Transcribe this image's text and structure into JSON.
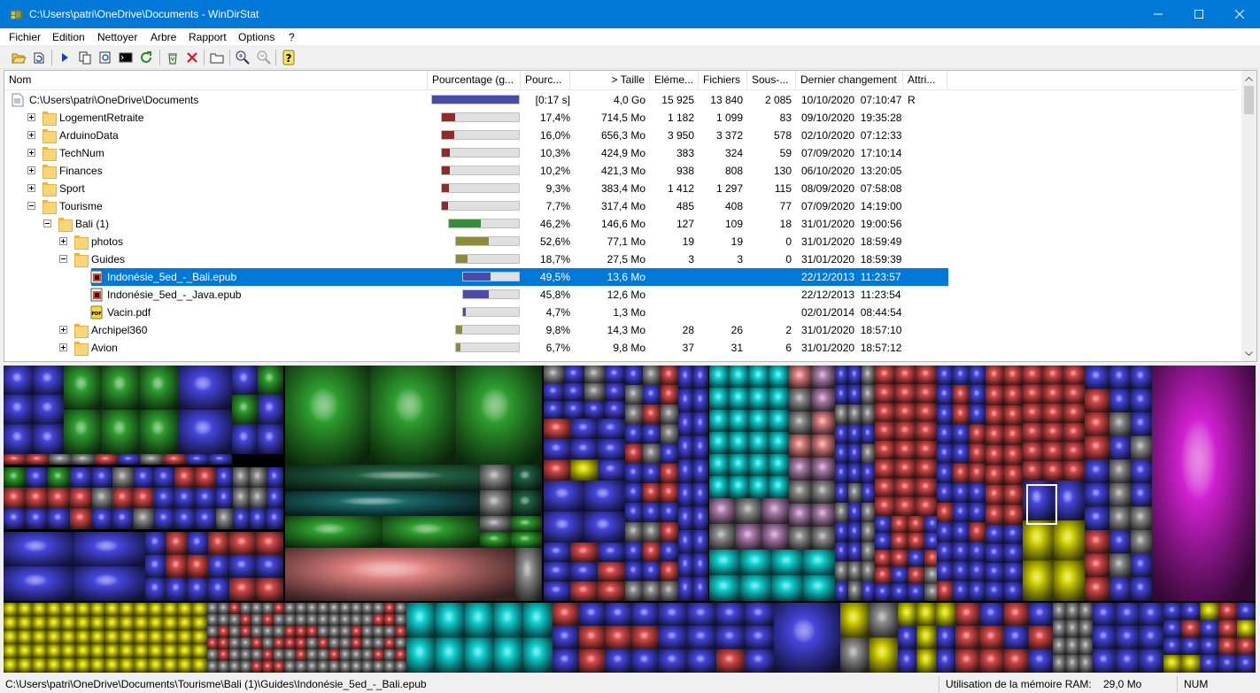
{
  "window": {
    "title": "C:\\Users\\patri\\OneDrive\\Documents - WinDirStat",
    "minimize_icon": "minimize-icon",
    "maximize_icon": "maximize-icon",
    "close_icon": "close-icon"
  },
  "menu": [
    "Fichier",
    "Edition",
    "Nettoyer",
    "Arbre",
    "Rapport",
    "Options",
    "?"
  ],
  "toolbar": {
    "icons": [
      "open-icon",
      "refresh-all-icon",
      "play-icon",
      "copy-path-icon",
      "explorer-icon",
      "command-prompt-icon",
      "refresh-icon",
      "recycle-bin-icon",
      "delete-icon",
      "new-folder-icon",
      "zoom-in-icon",
      "zoom-out-icon",
      "help-icon"
    ]
  },
  "columns": {
    "nom": "Nom",
    "pourcentage_graph": "Pourcentage (g...",
    "pourcentage": "Pourc...",
    "taille": "> Taille",
    "elements": "Eléme...",
    "fichiers": "Fichiers",
    "sous_dossiers": "Sous-...",
    "dernier_changement": "Dernier changement",
    "attributs": "Attri..."
  },
  "rows": [
    {
      "name": "C:\\Users\\patri\\OneDrive\\Documents",
      "type": "root",
      "bar_fraction": 1.0,
      "bar_color": "#4a4aa8",
      "pct": "[0:17 s]",
      "size": "4,0 Go",
      "items": "15 925",
      "files": "13 840",
      "subdirs": "2 085",
      "date": "10/10/2020  07:10:47",
      "attr": "R"
    },
    {
      "name": "LogementRetraite",
      "type": "folder",
      "expander": "plus",
      "bar_fraction": 0.174,
      "bar_color": "#8b2b2b",
      "pct": "17,4%",
      "size": "714,5 Mo",
      "items": "1 182",
      "files": "1 099",
      "subdirs": "83",
      "date": "09/10/2020  19:35:28",
      "attr": ""
    },
    {
      "name": "ArduinoData",
      "type": "folder",
      "expander": "plus",
      "bar_fraction": 0.16,
      "bar_color": "#8b2b2b",
      "pct": "16,0%",
      "size": "656,3 Mo",
      "items": "3 950",
      "files": "3 372",
      "subdirs": "578",
      "date": "02/10/2020  07:12:33",
      "attr": ""
    },
    {
      "name": "TechNum",
      "type": "folder",
      "expander": "plus",
      "bar_fraction": 0.103,
      "bar_color": "#8b2b2b",
      "pct": "10,3%",
      "size": "424,9 Mo",
      "items": "383",
      "files": "324",
      "subdirs": "59",
      "date": "07/09/2020  17:10:14",
      "attr": ""
    },
    {
      "name": "Finances",
      "type": "folder",
      "expander": "plus",
      "bar_fraction": 0.102,
      "bar_color": "#8b2b2b",
      "pct": "10,2%",
      "size": "421,3 Mo",
      "items": "938",
      "files": "808",
      "subdirs": "130",
      "date": "06/10/2020  13:20:05",
      "attr": ""
    },
    {
      "name": "Sport",
      "type": "folder",
      "expander": "plus",
      "bar_fraction": 0.093,
      "bar_color": "#8b2b2b",
      "pct": "9,3%",
      "size": "383,4 Mo",
      "items": "1 412",
      "files": "1 297",
      "subdirs": "115",
      "date": "08/09/2020  07:58:08",
      "attr": ""
    },
    {
      "name": "Tourisme",
      "type": "folder",
      "expander": "minus",
      "bar_fraction": 0.077,
      "bar_color": "#8b2b2b",
      "pct": "7,7%",
      "size": "317,4 Mo",
      "items": "485",
      "files": "408",
      "subdirs": "77",
      "date": "07/09/2020  14:19:00",
      "attr": ""
    },
    {
      "name": "Bali (1)",
      "type": "folder",
      "expander": "minus",
      "bar_fraction": 0.462,
      "bar_color": "#3a8a3a",
      "pct": "46,2%",
      "size": "146,6 Mo",
      "items": "127",
      "files": "109",
      "subdirs": "18",
      "date": "31/01/2020  19:00:56",
      "attr": ""
    },
    {
      "name": "photos",
      "type": "folder",
      "expander": "plus",
      "bar_fraction": 0.526,
      "bar_color": "#8e8a3c",
      "pct": "52,6%",
      "size": "77,1 Mo",
      "items": "19",
      "files": "19",
      "subdirs": "0",
      "date": "31/01/2020  18:59:49",
      "attr": ""
    },
    {
      "name": "Guides",
      "type": "folder",
      "expander": "minus",
      "bar_fraction": 0.187,
      "bar_color": "#8e8a3c",
      "pct": "18,7%",
      "size": "27,5 Mo",
      "items": "3",
      "files": "3",
      "subdirs": "0",
      "date": "31/01/2020  18:59:39",
      "attr": ""
    },
    {
      "name": "Indonésie_5ed_-_Bali.epub",
      "type": "epub",
      "selected": true,
      "bar_fraction": 0.495,
      "bar_color": "#4a4aa8",
      "pct": "49,5%",
      "size": "13,6 Mo",
      "items": "",
      "files": "",
      "subdirs": "",
      "date": "22/12/2013  11:23:57",
      "attr": ""
    },
    {
      "name": "Indonésie_5ed_-_Java.epub",
      "type": "epub",
      "bar_fraction": 0.458,
      "bar_color": "#4a4aa8",
      "pct": "45,8%",
      "size": "12,6 Mo",
      "items": "",
      "files": "",
      "subdirs": "",
      "date": "22/12/2013  11:23:54",
      "attr": ""
    },
    {
      "name": "Vacin.pdf",
      "type": "pdf",
      "bar_fraction": 0.047,
      "bar_color": "#4a4aa8",
      "pct": "4,7%",
      "size": "1,3 Mo",
      "items": "",
      "files": "",
      "subdirs": "",
      "date": "02/01/2014  08:44:54",
      "attr": ""
    },
    {
      "name": "Archipel360",
      "type": "folder",
      "expander": "plus",
      "bar_fraction": 0.098,
      "bar_color": "#8e8a3c",
      "pct": "9,8%",
      "size": "14,3 Mo",
      "items": "28",
      "files": "26",
      "subdirs": "2",
      "date": "31/01/2020  18:57:10",
      "attr": ""
    },
    {
      "name": "Avion",
      "type": "folder",
      "expander": "plus",
      "bar_fraction": 0.067,
      "bar_color": "#8e8a3c",
      "pct": "6,7%",
      "size": "9,8 Mo",
      "items": "37",
      "files": "31",
      "subdirs": "6",
      "date": "31/01/2020  18:57:12",
      "attr": ""
    }
  ],
  "treemap": {
    "colors": {
      "blue": "#4646e0",
      "green": "#2e9e2e",
      "red": "#d84a4a",
      "cyan": "#12d6d6",
      "yellow": "#d6d600",
      "magenta": "#d020d0",
      "gray": "#909090",
      "darkgreen": "#1f5f3f",
      "salmon": "#e08080",
      "pinkgray": "#b080b0",
      "teal": "#1a6a6a",
      "olive": "#a0a000"
    },
    "highlighted_item": "Indonésie_5ed_-_Bali.epub"
  },
  "status": {
    "path": "C:\\Users\\patri\\OneDrive\\Documents\\Tourisme\\Bali (1)\\Guides\\Indonésie_5ed_-_Bali.epub",
    "memory_label": "Utilisation de la mémoire RAM:",
    "memory_value": "29,0 Mo",
    "num": "NUM"
  }
}
